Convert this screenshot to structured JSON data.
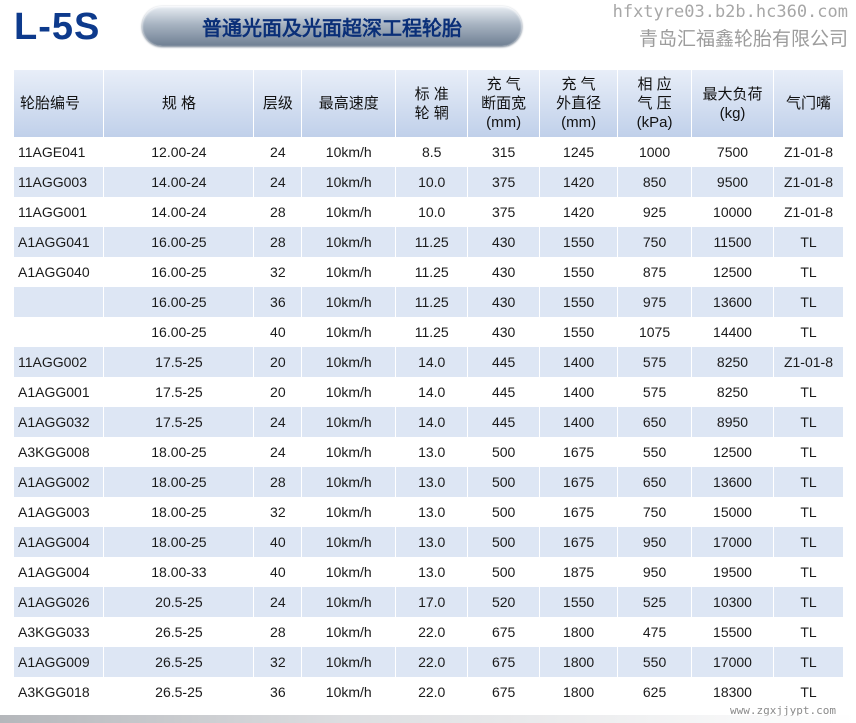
{
  "header": {
    "model": "L-5S",
    "banner": "普通光面及光面超深工程轮胎",
    "watermark_url": "hfxtyre03.b2b.hc360.com",
    "watermark_company": "青岛汇福鑫轮胎有限公司",
    "watermark_bottom": "www.zgxjjypt.com"
  },
  "table": {
    "headers": [
      {
        "l1": "轮胎编号"
      },
      {
        "l1": "规 格"
      },
      {
        "l1": "层级"
      },
      {
        "l1": "最高速度"
      },
      {
        "l1": "标 准",
        "l2": "轮 辋"
      },
      {
        "l1": "充  气",
        "l2": "断面宽",
        "l3": "(mm)"
      },
      {
        "l1": "充  气",
        "l2": "外直径",
        "l3": "(mm)"
      },
      {
        "l1": "相 应",
        "l2": "气 压",
        "l3": "(kPa)"
      },
      {
        "l1": "最大负荷",
        "l2": "(kg)"
      },
      {
        "l1": "气门嘴"
      }
    ],
    "rows": [
      [
        "11AGE041",
        "12.00-24",
        "24",
        "10km/h",
        "8.5",
        "315",
        "1245",
        "1000",
        "7500",
        "Z1-01-8"
      ],
      [
        "11AGG003",
        "14.00-24",
        "24",
        "10km/h",
        "10.0",
        "375",
        "1420",
        "850",
        "9500",
        "Z1-01-8"
      ],
      [
        "11AGG001",
        "14.00-24",
        "28",
        "10km/h",
        "10.0",
        "375",
        "1420",
        "925",
        "10000",
        "Z1-01-8"
      ],
      [
        "A1AGG041",
        "16.00-25",
        "28",
        "10km/h",
        "11.25",
        "430",
        "1550",
        "750",
        "11500",
        "TL"
      ],
      [
        "A1AGG040",
        "16.00-25",
        "32",
        "10km/h",
        "11.25",
        "430",
        "1550",
        "875",
        "12500",
        "TL"
      ],
      [
        "",
        "16.00-25",
        "36",
        "10km/h",
        "11.25",
        "430",
        "1550",
        "975",
        "13600",
        "TL"
      ],
      [
        "",
        "16.00-25",
        "40",
        "10km/h",
        "11.25",
        "430",
        "1550",
        "1075",
        "14400",
        "TL"
      ],
      [
        "11AGG002",
        "17.5-25",
        "20",
        "10km/h",
        "14.0",
        "445",
        "1400",
        "575",
        "8250",
        "Z1-01-8"
      ],
      [
        "A1AGG001",
        "17.5-25",
        "20",
        "10km/h",
        "14.0",
        "445",
        "1400",
        "575",
        "8250",
        "TL"
      ],
      [
        "A1AGG032",
        "17.5-25",
        "24",
        "10km/h",
        "14.0",
        "445",
        "1400",
        "650",
        "8950",
        "TL"
      ],
      [
        "A3KGG008",
        "18.00-25",
        "24",
        "10km/h",
        "13.0",
        "500",
        "1675",
        "550",
        "12500",
        "TL"
      ],
      [
        "A1AGG002",
        "18.00-25",
        "28",
        "10km/h",
        "13.0",
        "500",
        "1675",
        "650",
        "13600",
        "TL"
      ],
      [
        "A1AGG003",
        "18.00-25",
        "32",
        "10km/h",
        "13.0",
        "500",
        "1675",
        "750",
        "15000",
        "TL"
      ],
      [
        "A1AGG004",
        "18.00-25",
        "40",
        "10km/h",
        "13.0",
        "500",
        "1675",
        "950",
        "17000",
        "TL"
      ],
      [
        "A1AGG004",
        "18.00-33",
        "40",
        "10km/h",
        "13.0",
        "500",
        "1875",
        "950",
        "19500",
        "TL"
      ],
      [
        "A1AGG026",
        "20.5-25",
        "24",
        "10km/h",
        "17.0",
        "520",
        "1550",
        "525",
        "10300",
        "TL"
      ],
      [
        "A3KGG033",
        "26.5-25",
        "28",
        "10km/h",
        "22.0",
        "675",
        "1800",
        "475",
        "15500",
        "TL"
      ],
      [
        "A1AGG009",
        "26.5-25",
        "32",
        "10km/h",
        "22.0",
        "675",
        "1800",
        "550",
        "17000",
        "TL"
      ],
      [
        "A3KGG018",
        "26.5-25",
        "36",
        "10km/h",
        "22.0",
        "675",
        "1800",
        "625",
        "18300",
        "TL"
      ]
    ]
  }
}
